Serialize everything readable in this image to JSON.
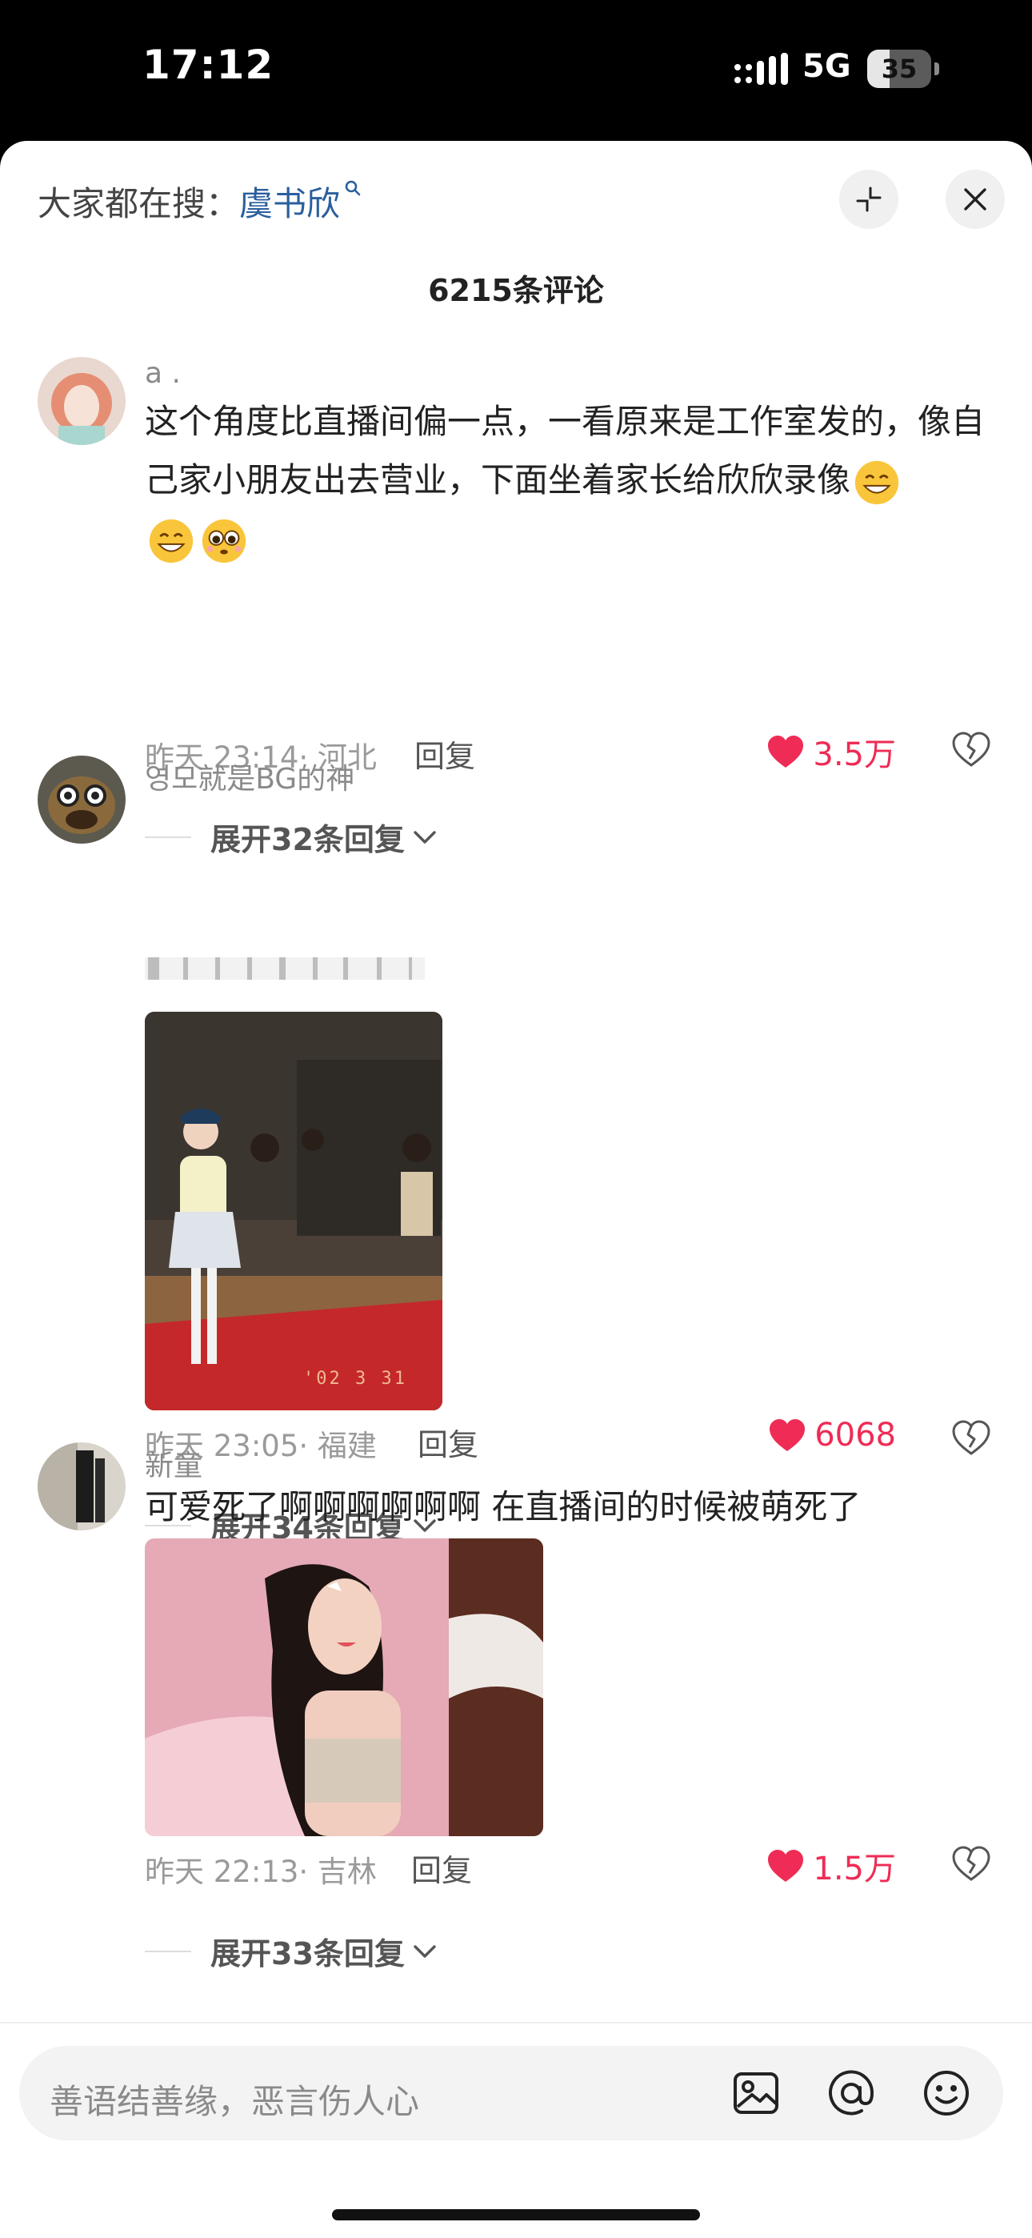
{
  "status_bar": {
    "time": "17:12",
    "network": "5G",
    "battery": "35",
    "battery_level": 0.35
  },
  "search_bar": {
    "prefix": "大家都在搜：",
    "keyword": "虞书欣"
  },
  "header": {
    "comment_count": "6215条评论"
  },
  "comments": [
    {
      "username": "a .",
      "text": "这个角度比直播间偏一点，一看原来是工作室发的，像自己家小朋友出去营业，下面坐着家长给欣欣录像",
      "time": "昨天 23:14",
      "location": "河北",
      "reply_label": "回复",
      "likes": "3.5万",
      "expand_label": "展开32条回复"
    },
    {
      "username": "영모就是BG的神",
      "photo_caption": "'02 3 31",
      "time": "昨天 23:05",
      "location": "福建",
      "reply_label": "回复",
      "likes": "6068",
      "expand_label": "展开34条回复"
    },
    {
      "username": "新童",
      "text": "可爱死了啊啊啊啊啊啊 在直播间的时候被萌死了",
      "time": "昨天 22:13",
      "location": "吉林",
      "reply_label": "回复",
      "likes": "1.5万",
      "expand_label": "展开33条回复"
    }
  ],
  "input": {
    "placeholder": "善语结善缘，恶言伤人心"
  },
  "icons": [
    "search-icon",
    "collapse-icon",
    "close-icon",
    "heart-icon",
    "dislike-icon",
    "chevron-down-icon",
    "image-icon",
    "at-icon",
    "emoji-icon"
  ],
  "colors": {
    "accent": "#ee2c55",
    "link": "#2a5f9e"
  }
}
